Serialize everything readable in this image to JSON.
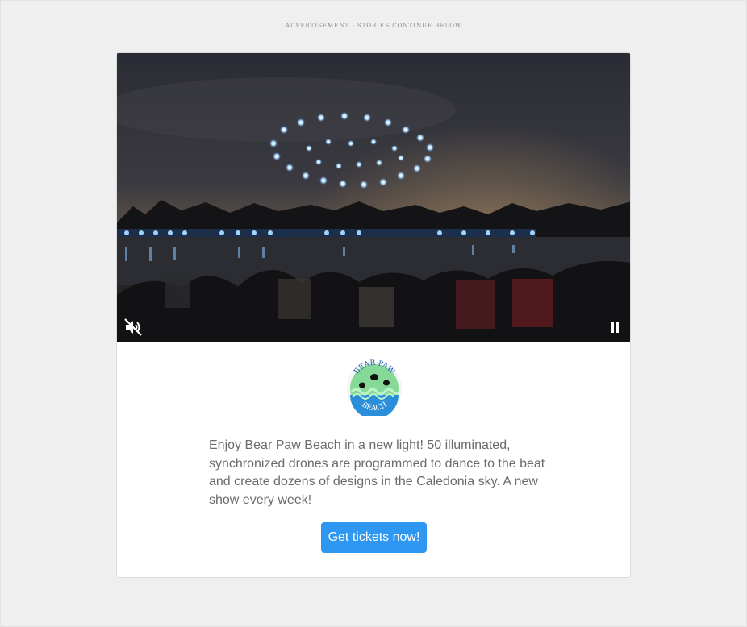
{
  "ad": {
    "label": "ADVERTISEMENT - STORIES CONTINUE BELOW"
  },
  "video": {
    "mute_icon": "muted-speaker-icon",
    "pause_icon": "pause-icon"
  },
  "brand": {
    "logo_top_text": "BEAR PAW",
    "logo_bottom_text": "BEACH"
  },
  "promo": {
    "body": "Enjoy Bear Paw Beach in a new light! 50 illuminated, synchronized drones are programmed to dance to the beat and create dozens of designs in the Caledonia sky. A new show every week!",
    "cta_label": "Get tickets now!"
  },
  "colors": {
    "page_background": "#efefef",
    "cta_background": "#2d97f1",
    "body_text": "#6b6b6b"
  }
}
